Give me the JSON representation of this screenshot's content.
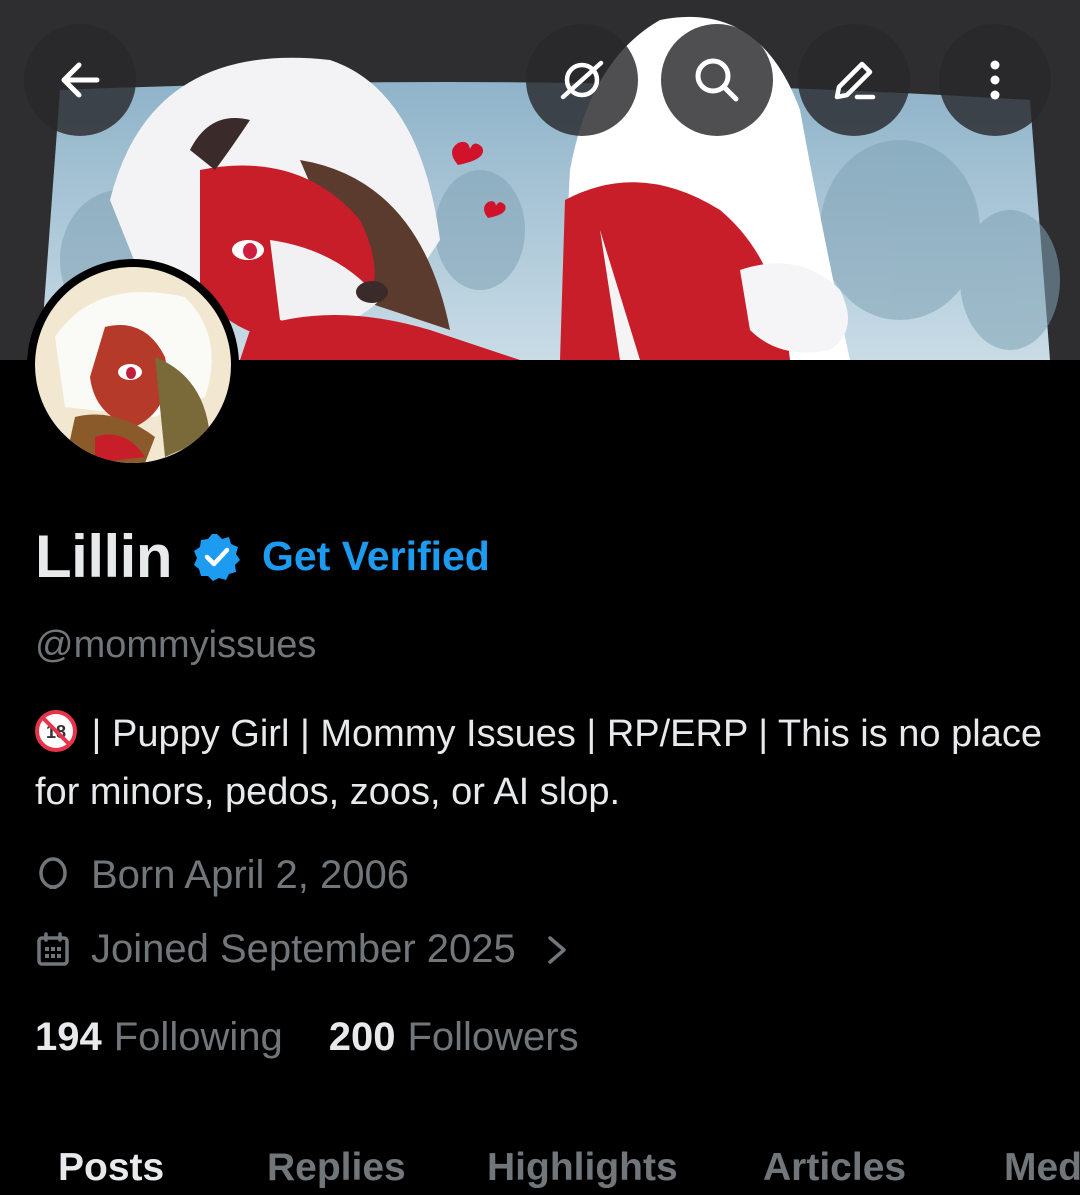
{
  "header": {
    "back_icon": "arrow-left-icon",
    "grok_icon": "grok-icon",
    "search_icon": "search-icon",
    "edit_icon": "pencil-icon",
    "more_icon": "more-vertical-icon"
  },
  "profile": {
    "display_name": "Lillin",
    "verified_icon": "verified-badge-icon",
    "get_verified_label": "Get Verified",
    "handle": "@mommyissues",
    "bio_badge": "18-plus-prohibited-icon",
    "bio_text": " | Puppy Girl | Mommy Issues | RP/ERP | This is no place for minors, pedos, zoos, or AI slop.",
    "born": "Born April 2, 2006",
    "joined": "Joined September 2025",
    "following_count": "194",
    "following_label": "Following",
    "followers_count": "200",
    "followers_label": "Followers"
  },
  "tabs": [
    {
      "label": "Posts",
      "active": true
    },
    {
      "label": "Replies",
      "active": false
    },
    {
      "label": "Highlights",
      "active": false
    },
    {
      "label": "Articles",
      "active": false
    },
    {
      "label": "Media",
      "active": false
    }
  ],
  "colors": {
    "accent": "#1d9bf0",
    "text_primary": "#e7e9ea",
    "text_secondary": "#71767b",
    "background": "#000000"
  }
}
